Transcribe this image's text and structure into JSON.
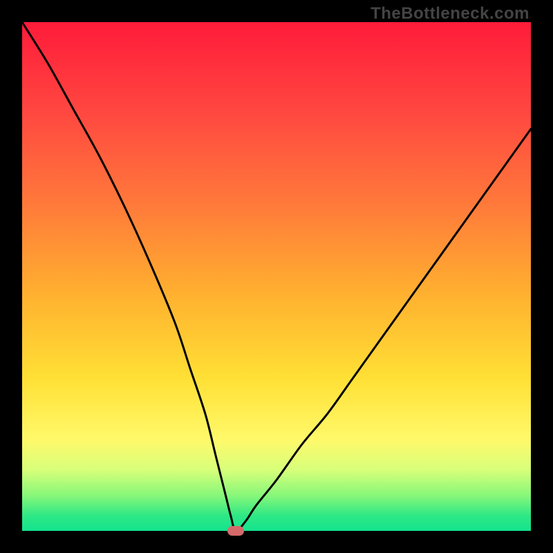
{
  "watermark": "TheBottleneck.com",
  "gradient_colors": [
    "#ff1b3a",
    "#ff4840",
    "#ff7a3a",
    "#ffb22f",
    "#ffe035",
    "#fff96a",
    "#d8ff7a",
    "#88f77a",
    "#2ee885",
    "#14e38e"
  ],
  "marker_color": "#d46a6a",
  "chart_data": {
    "type": "line",
    "title": "",
    "xlabel": "",
    "ylabel": "",
    "xlim": [
      0,
      100
    ],
    "ylim": [
      0,
      100
    ],
    "min_point": {
      "x": 42,
      "y": 0
    },
    "series": [
      {
        "name": "bottleneck-curve",
        "x": [
          0,
          5,
          10,
          15,
          20,
          25,
          30,
          33,
          36,
          38,
          40,
          41,
          42,
          44,
          46,
          50,
          55,
          60,
          65,
          70,
          75,
          80,
          85,
          90,
          95,
          100
        ],
        "values": [
          100,
          92,
          83,
          74,
          64,
          53,
          41,
          32,
          23,
          15,
          7,
          3,
          0,
          2,
          5,
          10,
          17,
          23,
          30,
          37,
          44,
          51,
          58,
          65,
          72,
          79
        ]
      }
    ]
  }
}
